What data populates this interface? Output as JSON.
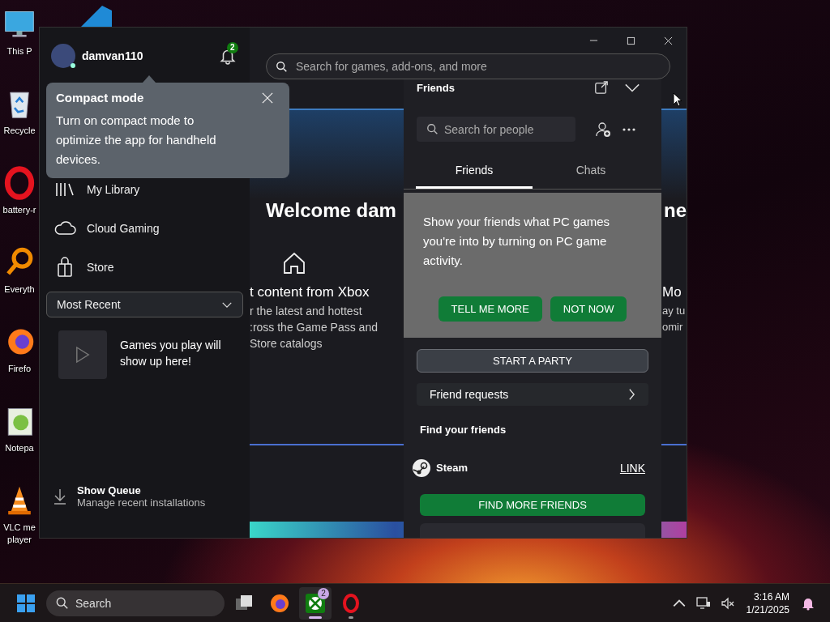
{
  "desktop": {
    "icons": [
      {
        "kind": "monitor",
        "label": "This P"
      },
      {
        "kind": "recycle-bin",
        "label": "Recycle"
      },
      {
        "kind": "opera",
        "label": "battery-r"
      },
      {
        "kind": "magnifier",
        "label": "Everyth"
      },
      {
        "kind": "firefox",
        "label": "Firefo"
      },
      {
        "kind": "notepad",
        "label": "Notepa"
      },
      {
        "kind": "cone",
        "label": "VLC me\nplayer"
      }
    ]
  },
  "window": {
    "user": {
      "name": "damvan110",
      "notifications": "2"
    },
    "tooltip": {
      "title": "Compact mode",
      "body": "Turn on compact mode to optimize the app for handheld devices."
    },
    "nav": [
      {
        "kind": "library",
        "label": "My Library"
      },
      {
        "kind": "cloud",
        "label": "Cloud Gaming"
      },
      {
        "kind": "store",
        "label": "Store"
      }
    ],
    "filter": {
      "value": "Most Recent"
    },
    "recent_empty": "Games you play will show up here!",
    "queue": {
      "title": "Show Queue",
      "subtitle": "Manage recent installations"
    },
    "search": {
      "placeholder": "Search for games, add-ons, and more"
    },
    "hero": {
      "title": "Welcome dam",
      "title_right": "ne"
    },
    "feature_left": {
      "title": "t content from Xbox",
      "lines": [
        "r the latest and hottest",
        ":ross the Game Pass and",
        "Store catalogs"
      ]
    },
    "feature_right": {
      "title": "Mo",
      "lines": [
        "ay tu",
        "omir"
      ]
    },
    "friends": {
      "title": "Friends",
      "search": {
        "placeholder": "Search for people"
      },
      "tabs": [
        {
          "label": "Friends",
          "selected": true
        },
        {
          "label": "Chats",
          "selected": false
        }
      ],
      "promo": {
        "text": "Show your friends what PC games you're into by turning on PC game activity.",
        "buttons": [
          "TELL ME MORE",
          "NOT NOW"
        ]
      },
      "party_button": "START A PARTY",
      "requests": "Friend requests",
      "find_heading": "Find your friends",
      "accounts": [
        {
          "name": "Steam",
          "action": "LINK"
        }
      ],
      "find_button": "FIND MORE FRIENDS"
    }
  },
  "taskbar": {
    "search": {
      "placeholder": "Search"
    },
    "apps": [
      {
        "kind": "task-view",
        "selected": false,
        "running": false
      },
      {
        "kind": "firefox",
        "selected": false,
        "running": false
      },
      {
        "kind": "xbox",
        "selected": true,
        "running": true,
        "badge": "2"
      },
      {
        "kind": "opera",
        "selected": false,
        "running": true
      }
    ],
    "time": "3:16 AM",
    "date": "1/21/2025"
  }
}
